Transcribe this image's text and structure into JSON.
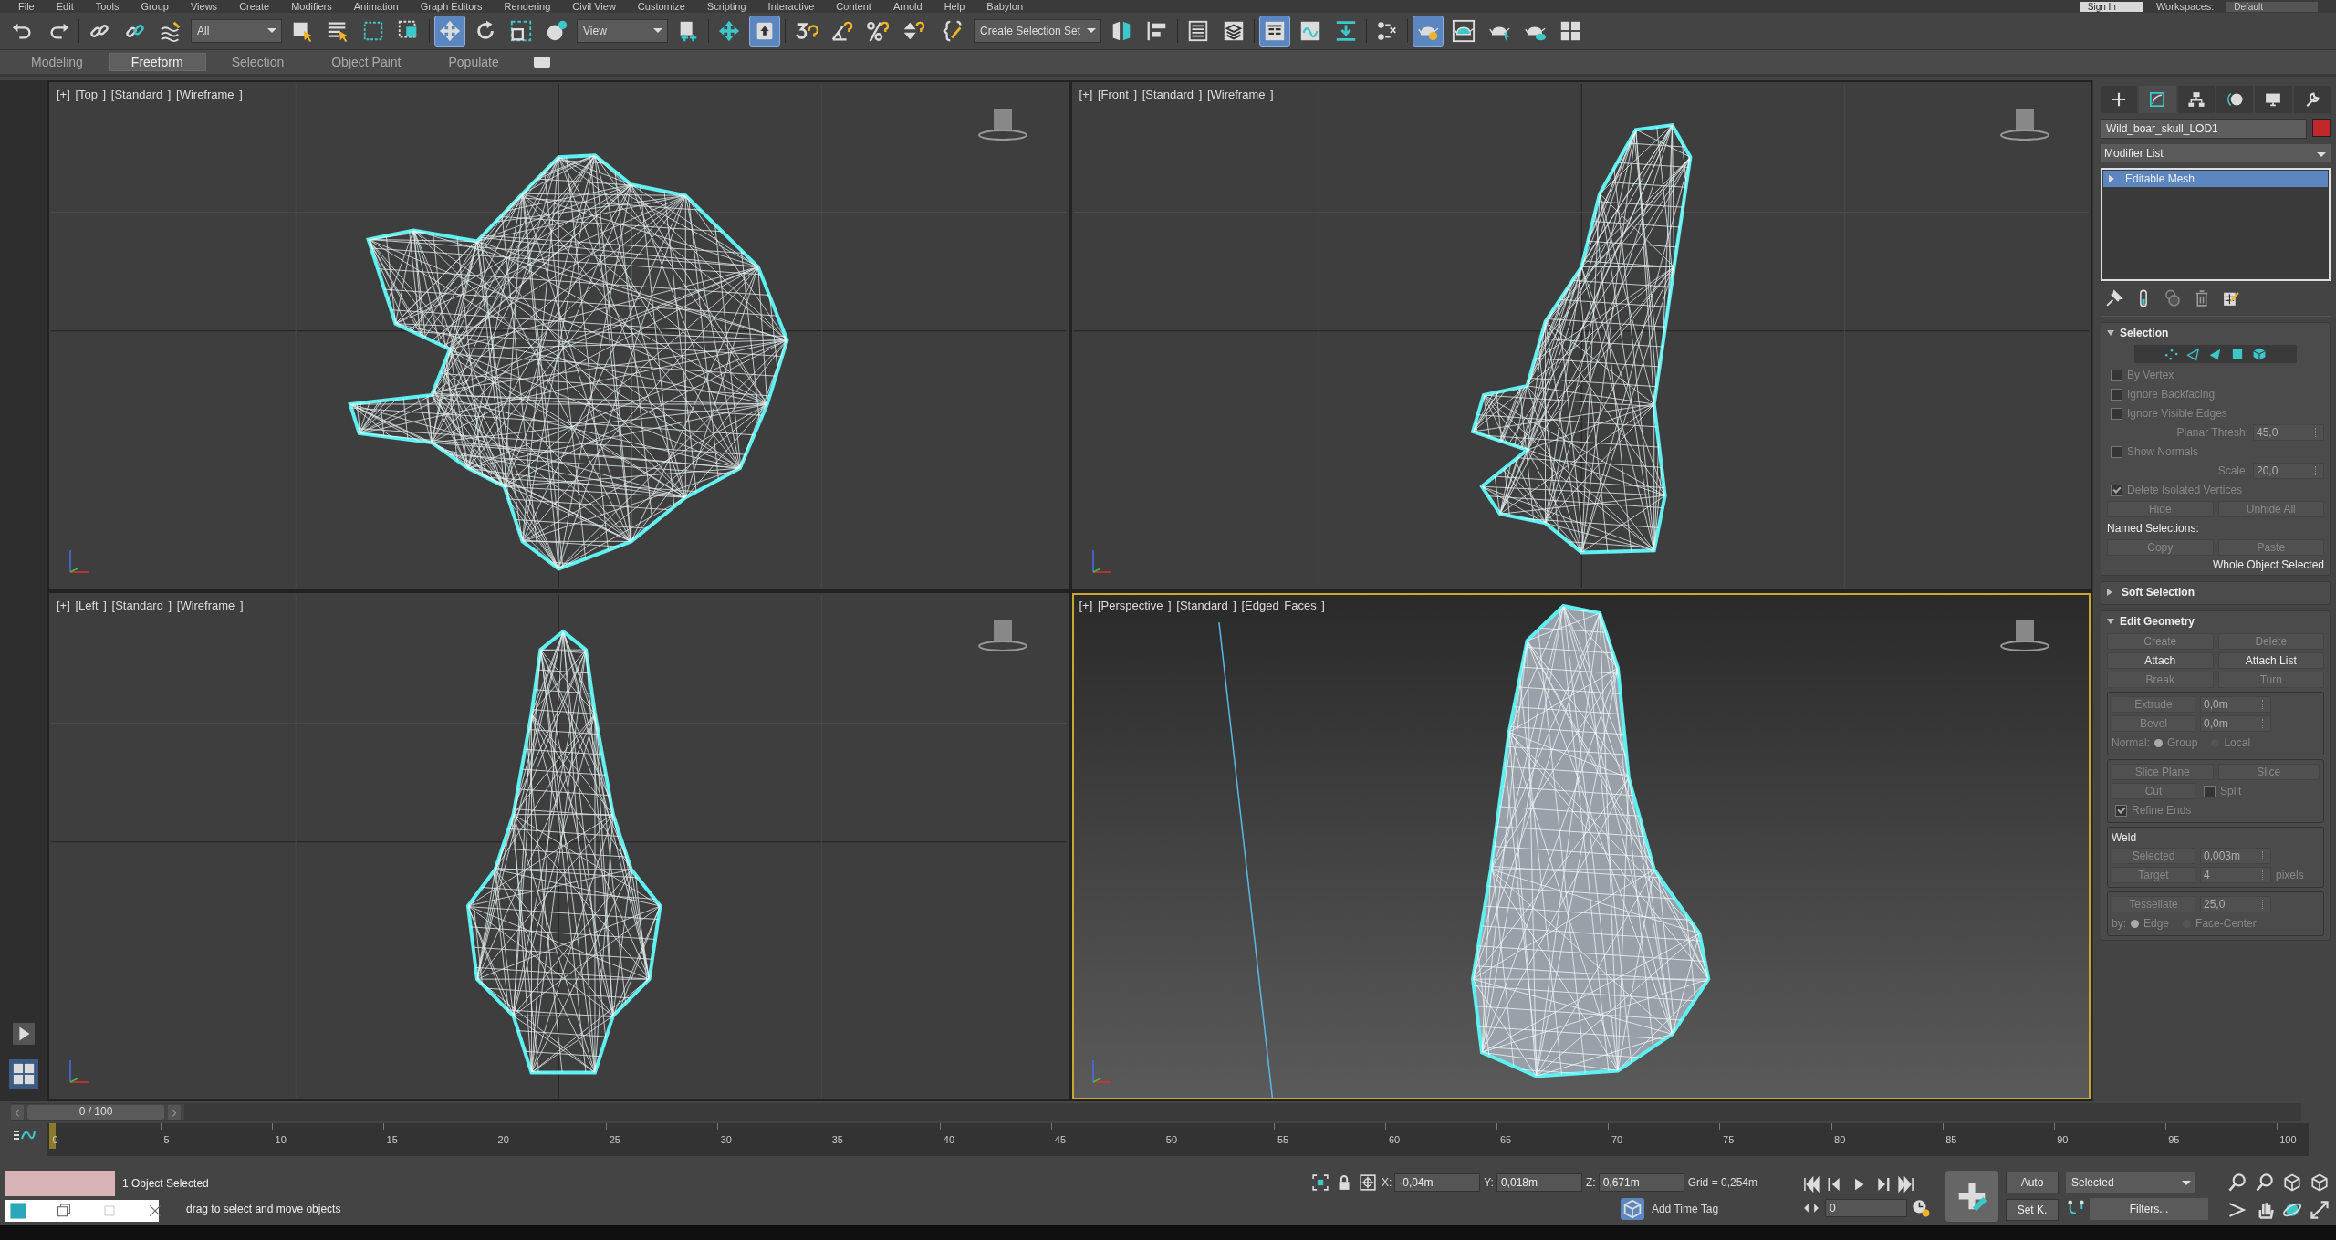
{
  "menu": [
    "File",
    "Edit",
    "Tools",
    "Group",
    "Views",
    "Create",
    "Modifiers",
    "Animation",
    "Graph Editors",
    "Rendering",
    "Civil View",
    "Customize",
    "Scripting",
    "Interactive",
    "Content",
    "Arnold",
    "Help",
    "Babylon"
  ],
  "account": {
    "sign_in": "Sign In",
    "workspaces_label": "Workspaces:",
    "workspace": "Default"
  },
  "toolbar": [
    {
      "kind": "undo",
      "selected": false
    },
    {
      "kind": "redo",
      "selected": false
    },
    {
      "kind": "sep"
    },
    {
      "kind": "link",
      "selected": false
    },
    {
      "kind": "unlink",
      "selected": false
    },
    {
      "kind": "bind",
      "selected": false
    },
    {
      "kind": "dropdown",
      "value": "All"
    },
    {
      "kind": "select",
      "selected": false
    },
    {
      "kind": "select-name",
      "selected": false
    },
    {
      "kind": "region",
      "selected": false
    },
    {
      "kind": "crossing",
      "selected": false
    },
    {
      "kind": "sep"
    },
    {
      "kind": "move",
      "selected": true
    },
    {
      "kind": "rotate",
      "selected": false
    },
    {
      "kind": "scale",
      "selected": false
    },
    {
      "kind": "place",
      "selected": false
    },
    {
      "kind": "dropdown",
      "value": "View"
    },
    {
      "kind": "pivot",
      "selected": false
    },
    {
      "kind": "sep"
    },
    {
      "kind": "manipulate",
      "selected": false
    },
    {
      "kind": "keyboard",
      "selected": true
    },
    {
      "kind": "sep"
    },
    {
      "kind": "snap",
      "selected": false
    },
    {
      "kind": "angle",
      "selected": false
    },
    {
      "kind": "percent",
      "selected": false
    },
    {
      "kind": "spinner",
      "selected": false
    },
    {
      "kind": "sep"
    },
    {
      "kind": "braces",
      "selected": false
    },
    {
      "kind": "dropdown",
      "value": "Create Selection Set"
    },
    {
      "kind": "mirror",
      "selected": false
    },
    {
      "kind": "align",
      "selected": false
    },
    {
      "kind": "sep"
    },
    {
      "kind": "list",
      "selected": false
    },
    {
      "kind": "layers",
      "selected": false
    },
    {
      "kind": "sep"
    },
    {
      "kind": "ribbon",
      "selected": true
    },
    {
      "kind": "curve",
      "selected": false
    },
    {
      "kind": "dope",
      "selected": false
    },
    {
      "kind": "sep"
    },
    {
      "kind": "schematic",
      "selected": false
    },
    {
      "kind": "sep"
    },
    {
      "kind": "teapot-gear",
      "selected": true
    },
    {
      "kind": "teapot-frame",
      "selected": false
    },
    {
      "kind": "teapot",
      "selected": false
    },
    {
      "kind": "teapot-cloud",
      "selected": false
    },
    {
      "kind": "gallery",
      "selected": false
    }
  ],
  "ribbon_tabs": [
    {
      "label": "Modeling",
      "selected": false
    },
    {
      "label": "Freeform",
      "selected": true
    },
    {
      "label": "Selection",
      "selected": false
    },
    {
      "label": "Object Paint",
      "selected": false
    },
    {
      "label": "Populate",
      "selected": false
    }
  ],
  "viewports": [
    {
      "label": "[+] [Top ] [Standard ] [Wireframe ]",
      "active": false,
      "kind": "wireframe"
    },
    {
      "label": "[+] [Front ] [Standard ] [Wireframe ]",
      "active": false,
      "kind": "wireframe"
    },
    {
      "label": "[+] [Left ] [Standard ] [Wireframe ]",
      "active": false,
      "kind": "wireframe"
    },
    {
      "label": "[+] [Perspective ] [Standard ] [Edged Faces ]",
      "active": true,
      "kind": "edged"
    }
  ],
  "command_tabs": [
    {
      "kind": "create",
      "selected": false
    },
    {
      "kind": "modify",
      "selected": true
    },
    {
      "kind": "hierarchy",
      "selected": false
    },
    {
      "kind": "motion",
      "selected": false
    },
    {
      "kind": "display",
      "selected": false
    },
    {
      "kind": "utilities",
      "selected": false
    }
  ],
  "object_name": "Wild_boar_skull_LOD1",
  "modifier_list": "Modifier List",
  "stack": [
    {
      "label": "Editable Mesh",
      "selected": true
    }
  ],
  "rollouts": [
    {
      "title": "Selection",
      "expanded": true,
      "subobjects": [
        {
          "kind": "vertex",
          "selected": false
        },
        {
          "kind": "edge",
          "selected": false
        },
        {
          "kind": "face",
          "selected": false
        },
        {
          "kind": "polygon",
          "selected": false
        },
        {
          "kind": "element",
          "selected": false
        }
      ],
      "groups": [
        {
          "boxed": false,
          "rows": [
            {
              "kind": "checkbox",
              "label": "By Vertex",
              "checked": false,
              "disabled": true
            },
            {
              "kind": "checkbox",
              "label": "Ignore Backfacing",
              "checked": false,
              "disabled": true
            },
            {
              "kind": "checkbox",
              "label": "Ignore Visible Edges",
              "checked": false,
              "disabled": true
            },
            {
              "kind": "spinner",
              "label": "Planar Thresh:",
              "value": "45,0",
              "disabled": true
            },
            {
              "kind": "checkbox",
              "label": "Show Normals",
              "checked": false,
              "disabled": true
            },
            {
              "kind": "spinner",
              "label": "Scale:",
              "value": "20,0",
              "disabled": true
            },
            {
              "kind": "checkbox",
              "label": "Delete Isolated Vertices",
              "checked": true,
              "disabled": true
            },
            {
              "kind": "buttons",
              "buttons": [
                {
                  "label": "Hide",
                  "disabled": true
                },
                {
                  "label": "Unhide All",
                  "disabled": true
                }
              ]
            },
            {
              "kind": "label",
              "text": "Named Selections:"
            },
            {
              "kind": "buttons",
              "buttons": [
                {
                  "label": "Copy",
                  "disabled": true
                },
                {
                  "label": "Paste",
                  "disabled": true
                }
              ]
            },
            {
              "kind": "note",
              "text": "Whole Object Selected"
            }
          ]
        }
      ]
    },
    {
      "title": "Soft Selection",
      "expanded": false
    },
    {
      "title": "Edit Geometry",
      "expanded": true,
      "groups": [
        {
          "boxed": false,
          "rows": [
            {
              "kind": "buttons",
              "buttons": [
                {
                  "label": "Create",
                  "disabled": true
                },
                {
                  "label": "Delete",
                  "disabled": true
                }
              ]
            },
            {
              "kind": "buttons",
              "buttons": [
                {
                  "label": "Attach",
                  "disabled": false
                },
                {
                  "label": "Attach List",
                  "disabled": false
                }
              ]
            },
            {
              "kind": "buttons",
              "buttons": [
                {
                  "label": "Break",
                  "disabled": true
                },
                {
                  "label": "Turn",
                  "disabled": true
                }
              ]
            }
          ]
        },
        {
          "boxed": true,
          "rows": [
            {
              "kind": "button-spinner",
              "label": "Extrude",
              "value": "0,0m",
              "disabled": true
            },
            {
              "kind": "button-spinner",
              "label": "Bevel",
              "value": "0,0m",
              "disabled": true
            },
            {
              "kind": "radio",
              "label": "Normal:",
              "disabled": true,
              "options": [
                {
                  "label": "Group",
                  "selected": true
                },
                {
                  "label": "Local",
                  "selected": false
                }
              ]
            }
          ]
        },
        {
          "boxed": true,
          "rows": [
            {
              "kind": "buttons",
              "buttons": [
                {
                  "label": "Slice Plane",
                  "disabled": true
                },
                {
                  "label": "Slice",
                  "disabled": true
                }
              ]
            },
            {
              "kind": "button-check",
              "label": "Cut",
              "check": "Split",
              "checked": false,
              "disabled": true
            },
            {
              "kind": "checkbox",
              "label": "Refine Ends",
              "checked": true,
              "disabled": true
            }
          ]
        },
        {
          "boxed": true,
          "title": "Weld",
          "rows": [
            {
              "kind": "button-spinner",
              "label": "Selected",
              "value": "0,003m",
              "disabled": true
            },
            {
              "kind": "button-spinner",
              "label": "Target",
              "value": "4",
              "suffix": "pixels",
              "disabled": true
            }
          ]
        },
        {
          "boxed": true,
          "rows": [
            {
              "kind": "button-spinner",
              "label": "Tessellate",
              "value": "25,0",
              "disabled": true
            },
            {
              "kind": "radio",
              "label": "by:",
              "disabled": true,
              "options": [
                {
                  "label": "Edge",
                  "selected": true
                },
                {
                  "label": "Face-Center",
                  "selected": false
                }
              ]
            }
          ]
        }
      ]
    }
  ],
  "timeline": {
    "frame": "0 / 100",
    "level": 0,
    "ticks": [
      "0",
      "5",
      "10",
      "15",
      "20",
      "25",
      "30",
      "35",
      "40",
      "45",
      "50",
      "55",
      "60",
      "65",
      "70",
      "75",
      "80",
      "85",
      "90",
      "95",
      "100"
    ]
  },
  "status": {
    "selection": "1 Object Selected",
    "prompt": "drag to select and move objects",
    "coords": [
      {
        "label": "X:",
        "value": "-0,04m"
      },
      {
        "label": "Y:",
        "value": "0,018m"
      },
      {
        "label": "Z:",
        "value": "0,671m"
      }
    ],
    "grid": "Grid = 0,254m",
    "time_tag": "Add Time Tag",
    "auto_key": "Auto",
    "set_key": "Set K.",
    "key_filter": "Selected",
    "filters": "Filters...",
    "current_frame": "0"
  }
}
